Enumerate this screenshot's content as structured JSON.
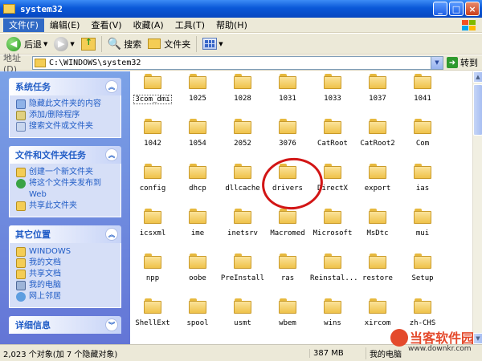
{
  "window": {
    "title": "system32"
  },
  "menu": [
    "文件(F)",
    "编辑(E)",
    "查看(V)",
    "收藏(A)",
    "工具(T)",
    "帮助(H)"
  ],
  "toolbar": {
    "back": "后退",
    "search": "搜索",
    "folders": "文件夹"
  },
  "address": {
    "label": "地址(D)",
    "path": "C:\\WINDOWS\\system32",
    "go": "转到"
  },
  "sidebar": {
    "panels": [
      {
        "title": "系统任务",
        "items": [
          "隐藏此文件夹的内容",
          "添加/删除程序",
          "搜索文件或文件夹"
        ]
      },
      {
        "title": "文件和文件夹任务",
        "items": [
          "创建一个新文件夹",
          "将这个文件夹发布到 Web",
          "共享此文件夹"
        ]
      },
      {
        "title": "其它位置",
        "items": [
          "WINDOWS",
          "我的文档",
          "共享文档",
          "我的电脑",
          "网上邻居"
        ]
      },
      {
        "title": "详细信息",
        "items": []
      }
    ]
  },
  "folders": [
    "3com_dmi",
    "1025",
    "1028",
    "1031",
    "1033",
    "1037",
    "1041",
    "1042",
    "1054",
    "2052",
    "3076",
    "CatRoot",
    "CatRoot2",
    "Com",
    "config",
    "dhcp",
    "dllcache",
    "drivers",
    "DirectX",
    "export",
    "ias",
    "icsxml",
    "ime",
    "inetsrv",
    "Macromed",
    "Microsoft",
    "MsDtc",
    "mui",
    "npp",
    "oobe",
    "PreInstall",
    "ras",
    "Reinstal...",
    "restore",
    "Setup",
    "ShellExt",
    "spool",
    "usmt",
    "wbem",
    "wins",
    "xircom",
    "zh-CHS"
  ],
  "status": {
    "count": "2,023 个对象(加 7 个隐藏对象)",
    "size": "387 MB",
    "location": "我的电脑"
  },
  "watermark": {
    "name": "当客软件园",
    "url": "www.downkr.com"
  }
}
